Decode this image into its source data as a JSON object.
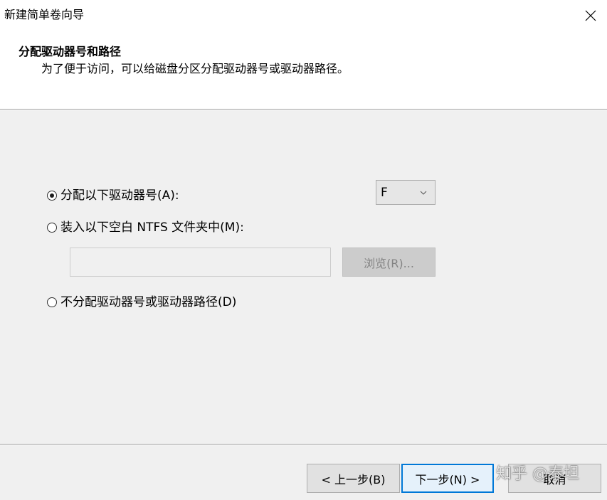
{
  "window": {
    "title": "新建简单卷向导"
  },
  "header": {
    "title": "分配驱动器号和路径",
    "subtitle": "为了便于访问，可以给磁盘分区分配驱动器号或驱动器路径。"
  },
  "options": {
    "assign_letter": {
      "label": "分配以下驱动器号(A):",
      "selected": true
    },
    "mount_folder": {
      "label": "装入以下空白 NTFS 文件夹中(M):",
      "selected": false
    },
    "no_assign": {
      "label": "不分配驱动器号或驱动器路径(D)",
      "selected": false
    }
  },
  "drive_letter": {
    "value": "F"
  },
  "folder_path": {
    "value": "",
    "placeholder": ""
  },
  "browse_button": {
    "label": "浏览(R)...",
    "enabled": false
  },
  "footer": {
    "back_label": "< 上一步(B)",
    "next_label": "下一步(N) >",
    "cancel_label": "取消"
  },
  "watermark": {
    "text": "知乎 @泰坦"
  },
  "colors": {
    "body_bg": "#f0f0f0",
    "primary_border": "#0078d7",
    "disabled_text": "#838383"
  },
  "icons": {
    "close": "close-icon",
    "dropdown": "chevron-down-icon"
  }
}
